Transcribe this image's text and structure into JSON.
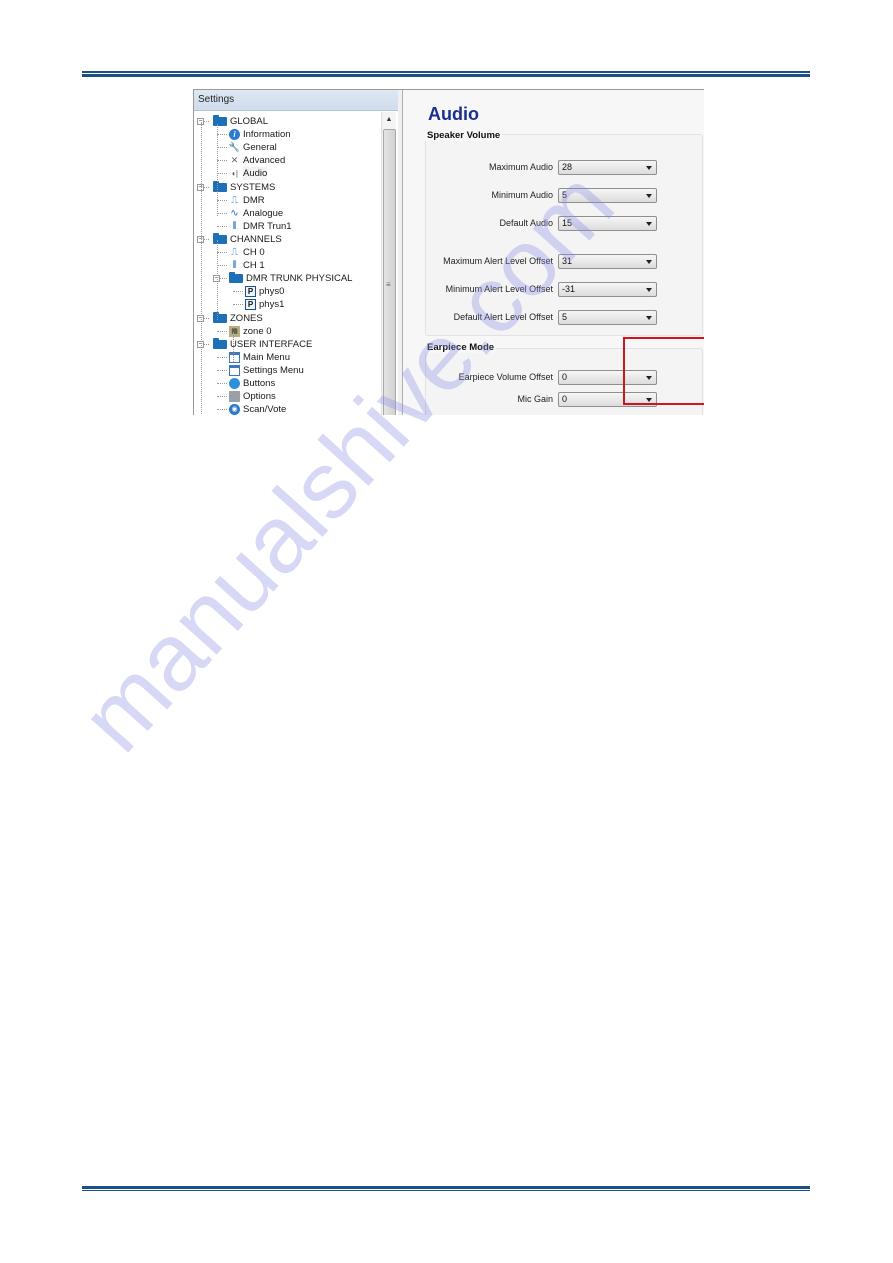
{
  "page": {
    "watermark": "manualshive.com"
  },
  "left_panel": {
    "header": "Settings",
    "tree": [
      {
        "label": "GLOBAL",
        "level": 0,
        "icon": "folder-icon",
        "expander": "−"
      },
      {
        "label": "Information",
        "level": 1,
        "icon": "info-icon"
      },
      {
        "label": "General",
        "level": 1,
        "icon": "wrench-icon"
      },
      {
        "label": "Advanced",
        "level": 1,
        "icon": "tools-icon"
      },
      {
        "label": "Audio",
        "level": 1,
        "icon": "speaker-icon",
        "selected": true
      },
      {
        "label": "SYSTEMS",
        "level": 0,
        "icon": "folder-icon",
        "expander": "−"
      },
      {
        "label": "DMR",
        "level": 1,
        "icon": "pulse-icon"
      },
      {
        "label": "Analogue",
        "level": 1,
        "icon": "sine-wave-icon"
      },
      {
        "label": "DMR Trun1",
        "level": 1,
        "icon": "double-pulse-icon"
      },
      {
        "label": "CHANNELS",
        "level": 0,
        "icon": "folder-icon",
        "expander": "−"
      },
      {
        "label": "CH 0",
        "level": 1,
        "icon": "pulse-icon"
      },
      {
        "label": "CH 1",
        "level": 1,
        "icon": "double-pulse-icon"
      },
      {
        "label": "DMR TRUNK PHYSICAL",
        "level": 1,
        "icon": "folder-icon",
        "expander": "−"
      },
      {
        "label": "phys0",
        "level": 2,
        "icon": "physical-channel-icon"
      },
      {
        "label": "phys1",
        "level": 2,
        "icon": "physical-channel-icon"
      },
      {
        "label": "ZONES",
        "level": 0,
        "icon": "folder-icon",
        "expander": "−"
      },
      {
        "label": "zone 0",
        "level": 1,
        "icon": "zone-icon"
      },
      {
        "label": "USER INTERFACE",
        "level": 0,
        "icon": "folder-icon",
        "expander": "−"
      },
      {
        "label": "Main Menu",
        "level": 1,
        "icon": "menu-window-icon"
      },
      {
        "label": "Settings Menu",
        "level": 1,
        "icon": "menu-window-icon"
      },
      {
        "label": "Buttons",
        "level": 1,
        "icon": "button-icon"
      },
      {
        "label": "Options",
        "level": 1,
        "icon": "options-icon"
      },
      {
        "label": "Scan/Vote",
        "level": 1,
        "icon": "scan-icon"
      }
    ]
  },
  "right_panel": {
    "title": "Audio",
    "speaker_volume": {
      "title": "Speaker Volume",
      "fields": [
        {
          "label": "Maximum Audio",
          "value": "28"
        },
        {
          "label": "Minimum Audio",
          "value": "5"
        },
        {
          "label": "Default Audio",
          "value": "15"
        },
        {
          "label": "Maximum Alert Level Offset",
          "value": "31"
        },
        {
          "label": "Minimum Alert Level Offset",
          "value": "-31"
        },
        {
          "label": "Default Alert Level Offset",
          "value": "5"
        }
      ]
    },
    "earpiece_mode": {
      "title": "Earpiece Mode",
      "fields": [
        {
          "label": "Earpiece Volume Offset",
          "value": "0"
        },
        {
          "label": "Mic Gain",
          "value": "0"
        }
      ]
    }
  },
  "colors": {
    "rule": "#1a4f8a",
    "title": "#1b2f8f",
    "highlight": "#d4141c",
    "folder": "#1d6fb8"
  }
}
